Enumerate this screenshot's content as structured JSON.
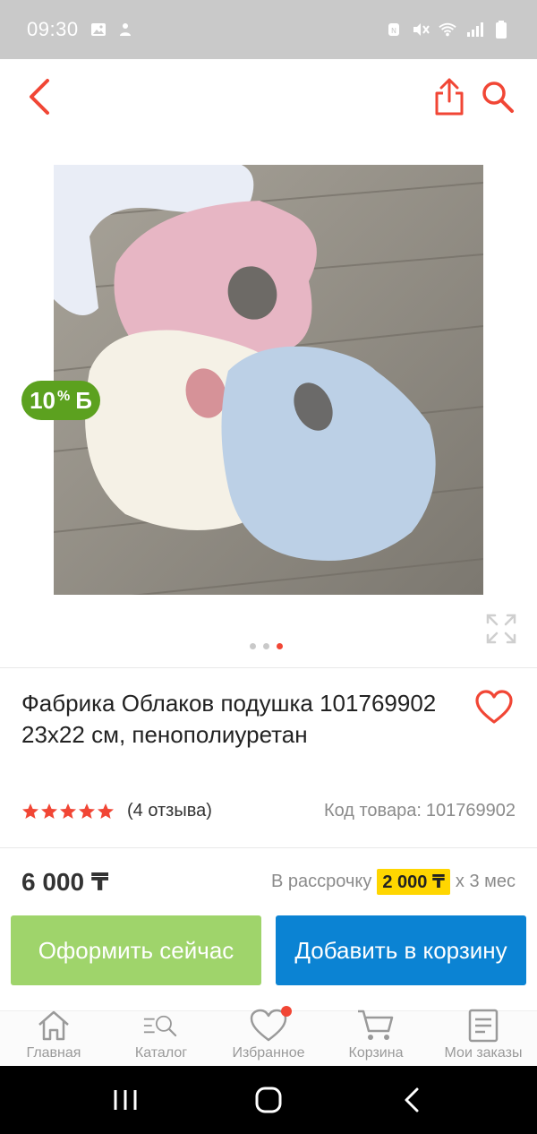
{
  "status_bar": {
    "time": "09:30"
  },
  "product": {
    "bonus_badge": {
      "value": "10",
      "pct": "%",
      "symbol": "Б"
    },
    "gallery_dots": 3,
    "gallery_active_index": 2,
    "title": "Фабрика Облаков подушка 101769902 23x22 см, пенополиуретан",
    "rating_stars": 5,
    "reviews": "(4 отзыва)",
    "sku_label": "Код товара:",
    "sku_value": "101769902",
    "price": "6 000 ₸",
    "installment_prefix": "В рассрочку",
    "installment_price": "2 000 ₸",
    "installment_suffix": "x 3 мес"
  },
  "buttons": {
    "checkout": "Оформить сейчас",
    "add_to_cart": "Добавить в корзину"
  },
  "bottom_nav": [
    {
      "label": "Главная",
      "icon": "home-icon"
    },
    {
      "label": "Каталог",
      "icon": "catalog-search-icon"
    },
    {
      "label": "Избранное",
      "icon": "heart-icon"
    },
    {
      "label": "Корзина",
      "icon": "cart-icon"
    },
    {
      "label": "Мои заказы",
      "icon": "orders-icon"
    }
  ],
  "colors": {
    "accent_red": "#f14635",
    "bonus_green": "#5ca11f",
    "checkout_green": "#9fd46b",
    "cart_blue": "#0b83d3",
    "installment_yellow": "#ffd600"
  }
}
